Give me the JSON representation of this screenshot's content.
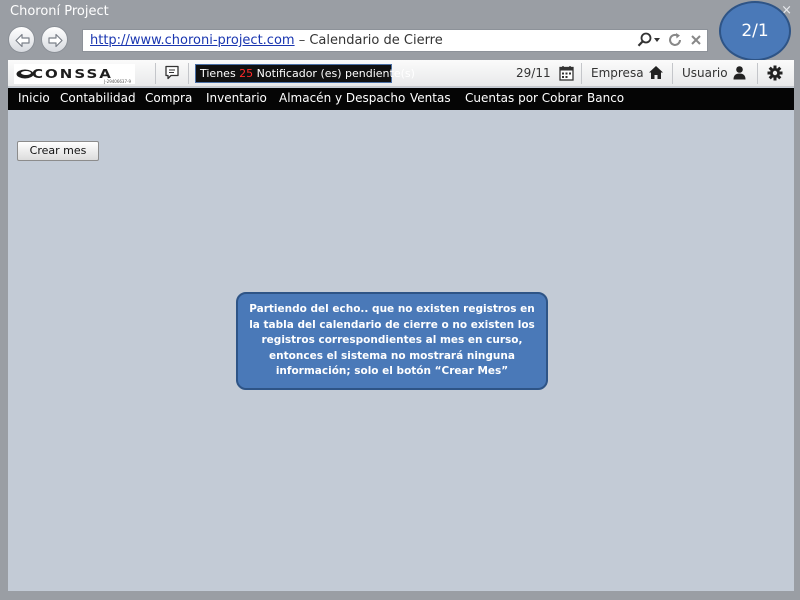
{
  "window": {
    "title": "Choroní Project",
    "close_label": "×"
  },
  "browser": {
    "url": "http://www.choroni-project.com",
    "separator": " – ",
    "page_title": "Calendario de Cierre"
  },
  "slide_badge": "2/1",
  "toolbar": {
    "logo_text": "CONSSA",
    "logo_sub": "J-29406637-9",
    "notification_prefix": "Tienes ",
    "notification_count": "25",
    "notification_suffix": " Notificador (es) pendiente(s)",
    "date": "29/11",
    "empresa_label": "Empresa",
    "usuario_label": "Usuario"
  },
  "menu": {
    "items": [
      {
        "label": "Inicio"
      },
      {
        "label": "Contabilidad"
      },
      {
        "label": "Compra"
      },
      {
        "label": "Inventario"
      },
      {
        "label": "Almacén y Despacho"
      },
      {
        "label": "Ventas"
      },
      {
        "label": "Cuentas por Cobrar"
      },
      {
        "label": "Banco"
      }
    ]
  },
  "main": {
    "create_button_label": "Crear mes"
  },
  "callout": {
    "text": "Partiendo del echo.. que no existen registros en la tabla del calendario de cierre o no existen los registros correspondientes al mes en curso, entonces el sistema no mostrará ninguna información; solo el botón “Crear Mes”"
  },
  "colors": {
    "accent": "#4a79b8",
    "menubar": "#050505",
    "content_bg": "#c3cbd6",
    "notification_count": "#ff2a2a"
  },
  "icons": [
    "back-arrow-icon",
    "forward-arrow-icon",
    "search-icon",
    "refresh-icon",
    "close-icon",
    "chat-icon",
    "calendar-icon",
    "home-icon",
    "user-icon",
    "gear-icon"
  ]
}
